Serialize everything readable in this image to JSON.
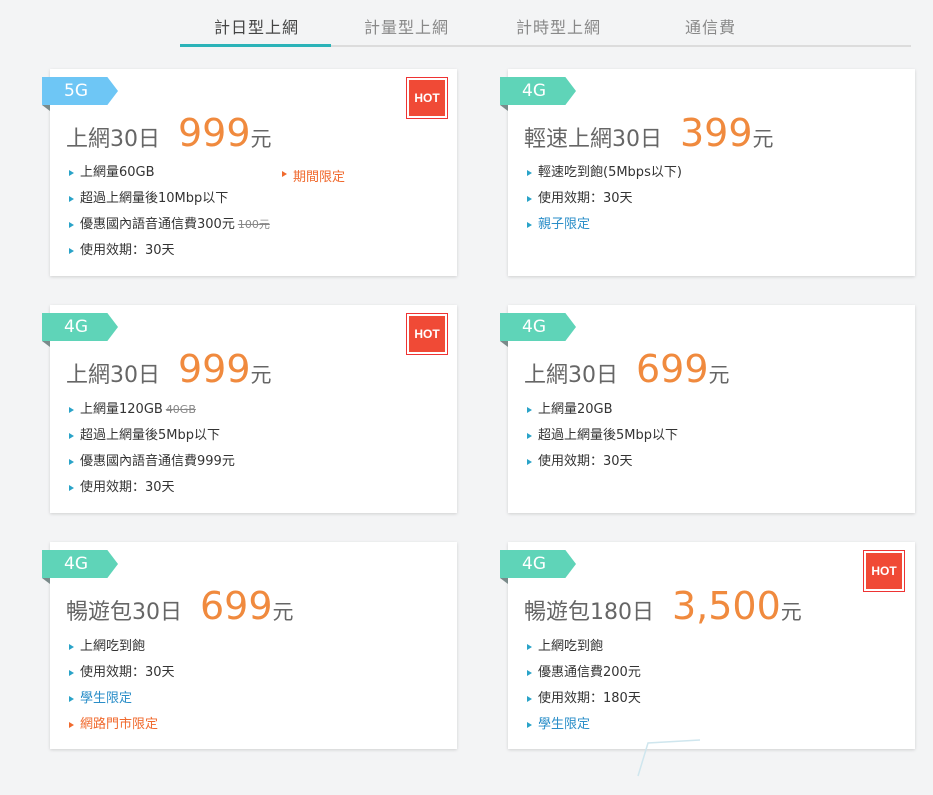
{
  "tabs": [
    {
      "label": "計日型上網",
      "active": true
    },
    {
      "label": "計量型上網",
      "active": false
    },
    {
      "label": "計時型上網",
      "active": false
    },
    {
      "label": "通信費",
      "active": false
    }
  ],
  "colors": {
    "accent": "#2bb3b8",
    "badge_5g": "#6ec6f5",
    "badge_4g": "#5fd4b8",
    "price": "#f08a3e",
    "hot": "#f04a36"
  },
  "cards": [
    {
      "network": "5G",
      "hot": true,
      "hot_label": "HOT",
      "name": "上網30日",
      "price": "999",
      "unit": "元",
      "side_tag": "期間限定",
      "features": [
        "上網量60GB",
        "超過上網量後10Mbp以下",
        "優惠國內語音通信費300元",
        "使用效期：30天"
      ],
      "strike": "100元"
    },
    {
      "network": "4G",
      "hot": false,
      "name": "輕速上網30日",
      "price": "399",
      "unit": "元",
      "features": [
        "輕速吃到飽(5Mbps以下)",
        "使用效期：30天",
        "親子限定"
      ]
    },
    {
      "network": "4G",
      "hot": true,
      "hot_label": "HOT",
      "name": "上網30日",
      "price": "999",
      "unit": "元",
      "features": [
        "上網量120GB",
        "超過上網量後5Mbp以下",
        "優惠國內語音通信費999元",
        "使用效期：30天"
      ],
      "strike": "40GB"
    },
    {
      "network": "4G",
      "hot": false,
      "name": "上網30日",
      "price": "699",
      "unit": "元",
      "features": [
        "上網量20GB",
        "超過上網量後5Mbp以下",
        "使用效期：30天"
      ]
    },
    {
      "network": "4G",
      "hot": false,
      "name": "暢遊包30日",
      "price": "699",
      "unit": "元",
      "features": [
        "上網吃到飽",
        "使用效期：30天",
        "學生限定",
        "網路門市限定"
      ]
    },
    {
      "network": "4G",
      "hot": true,
      "hot_label": "HOT",
      "name": "暢遊包180日",
      "price": "3,500",
      "unit": "元",
      "features": [
        "上網吃到飽",
        "優惠通信費200元",
        "使用效期：180天",
        "學生限定"
      ]
    }
  ]
}
